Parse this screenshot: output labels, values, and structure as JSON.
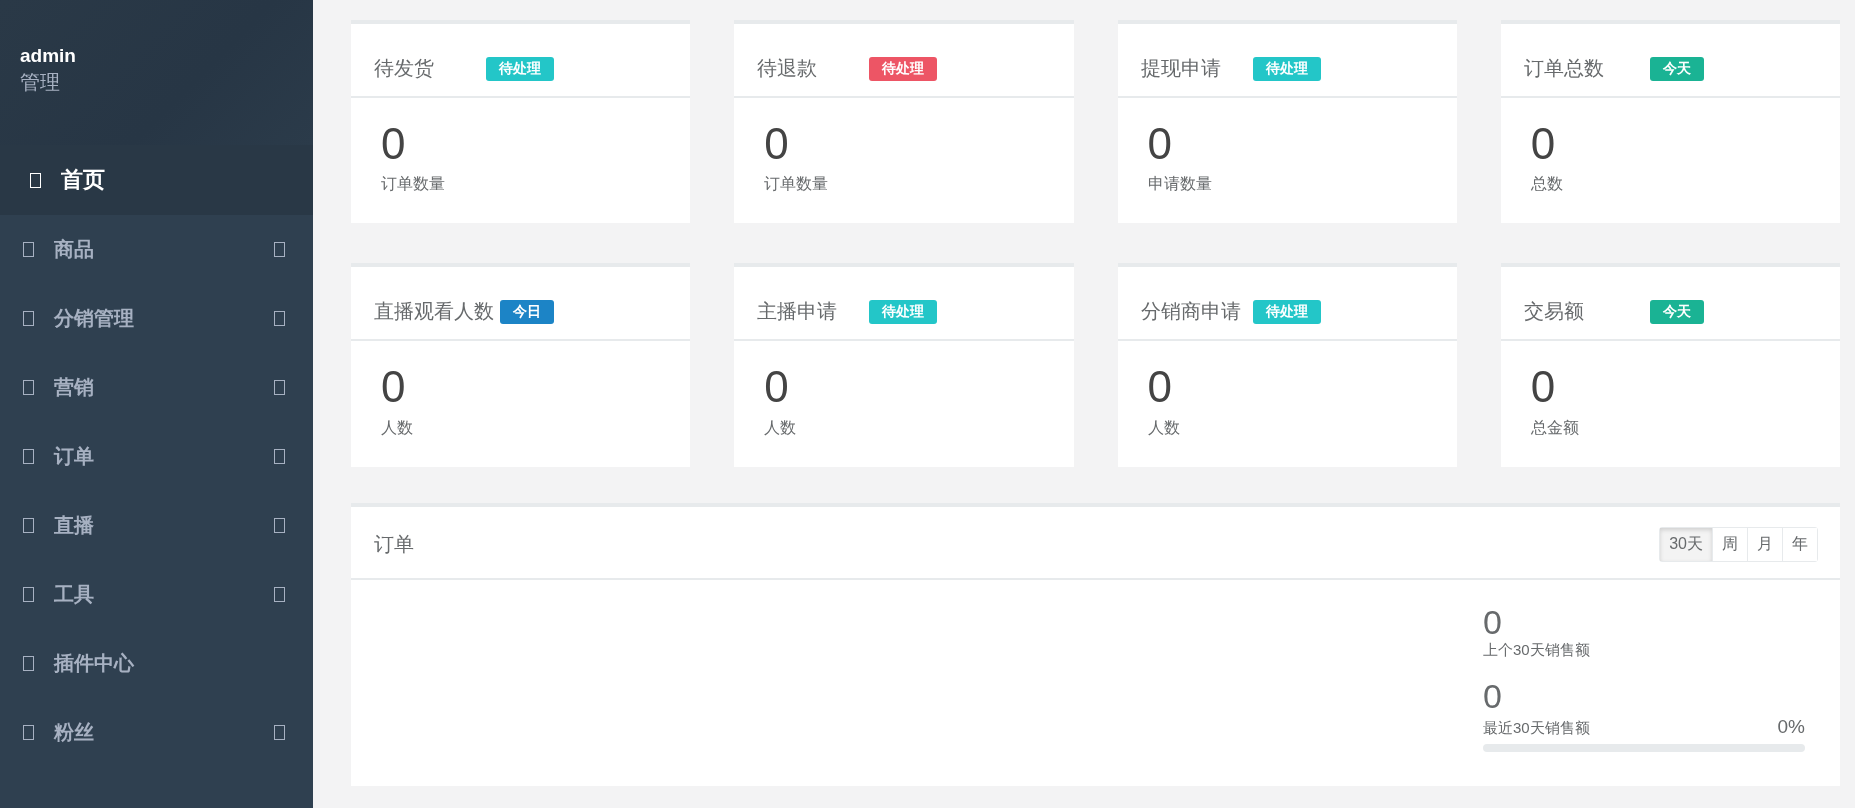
{
  "sidebar": {
    "user": {
      "name": "admin",
      "role": "管理"
    },
    "items": [
      {
        "label": "首页",
        "selected": true,
        "has_arrow": false
      },
      {
        "label": "商品",
        "selected": false,
        "has_arrow": true
      },
      {
        "label": "分销管理",
        "selected": false,
        "has_arrow": true
      },
      {
        "label": "营销",
        "selected": false,
        "has_arrow": true
      },
      {
        "label": "订单",
        "selected": false,
        "has_arrow": true
      },
      {
        "label": "直播",
        "selected": false,
        "has_arrow": true
      },
      {
        "label": "工具",
        "selected": false,
        "has_arrow": true
      },
      {
        "label": "插件中心",
        "selected": false,
        "has_arrow": false
      },
      {
        "label": "粉丝",
        "selected": false,
        "has_arrow": true
      }
    ]
  },
  "cards": [
    {
      "title": "待发货",
      "badge": {
        "text": "待处理",
        "color": "#23c6c8"
      },
      "value": "0",
      "caption": "订单数量"
    },
    {
      "title": "待退款",
      "badge": {
        "text": "待处理",
        "color": "#ed5565"
      },
      "value": "0",
      "caption": "订单数量"
    },
    {
      "title": "提现申请",
      "badge": {
        "text": "待处理",
        "color": "#23c6c8"
      },
      "value": "0",
      "caption": "申请数量"
    },
    {
      "title": "订单总数",
      "badge": {
        "text": "今天",
        "color": "#1ab394"
      },
      "value": "0",
      "caption": "总数"
    },
    {
      "title": "直播观看人数",
      "badge": {
        "text": "今日",
        "color": "#1c84c6"
      },
      "value": "0",
      "caption": "人数"
    },
    {
      "title": "主播申请",
      "badge": {
        "text": "待处理",
        "color": "#23c6c8"
      },
      "value": "0",
      "caption": "人数"
    },
    {
      "title": "分销商申请",
      "badge": {
        "text": "待处理",
        "color": "#23c6c8"
      },
      "value": "0",
      "caption": "人数"
    },
    {
      "title": "交易额",
      "badge": {
        "text": "今天",
        "color": "#1ab394"
      },
      "value": "0",
      "caption": "总金额"
    }
  ],
  "orders_panel": {
    "title": "订单",
    "periods": [
      {
        "label": "30天",
        "selected": true
      },
      {
        "label": "周",
        "selected": false
      },
      {
        "label": "月",
        "selected": false
      },
      {
        "label": "年",
        "selected": false
      }
    ],
    "stats": [
      {
        "value": "0",
        "caption": "上个30天销售额"
      },
      {
        "value": "0",
        "caption": "最近30天销售额",
        "percent": "0%",
        "level": 0
      }
    ]
  }
}
